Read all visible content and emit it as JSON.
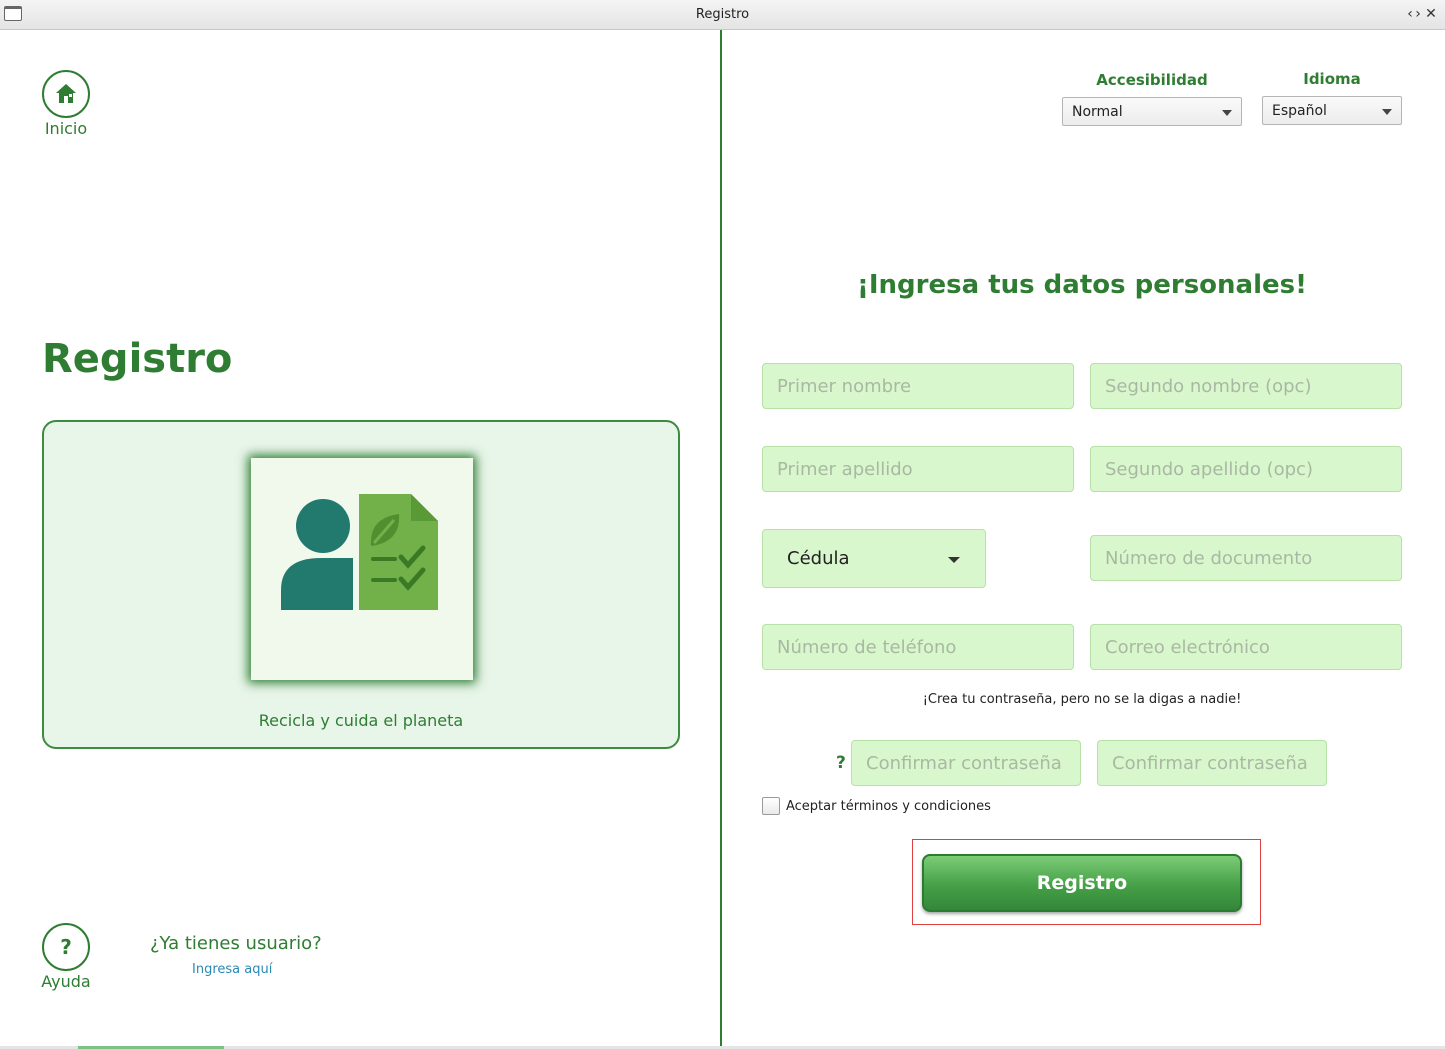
{
  "window": {
    "title": "Registro",
    "minimize_glyph": "‹",
    "maximize_glyph": "›",
    "close_glyph": "✕"
  },
  "left_panel": {
    "home": {
      "icon": "home-icon",
      "label": "Inicio"
    },
    "title": "Registro",
    "card": {
      "illustration": "user-eco-document-icon",
      "caption": "Recicla y cuida el planeta"
    },
    "help": {
      "icon": "question-icon",
      "glyph": "?",
      "label": "Ayuda"
    },
    "login_prompt": {
      "question": "¿Ya tienes usuario?",
      "link": "Ingresa aquí"
    }
  },
  "right_panel": {
    "accessibility": {
      "label": "Accesibilidad",
      "value": "Normal"
    },
    "language": {
      "label": "Idioma",
      "value": "Español"
    },
    "heading": "¡Ingresa tus datos personales!",
    "fields": {
      "first_name": "Primer nombre",
      "second_name": "Segundo nombre (opc)",
      "first_surname": "Primer apellido",
      "second_surname": "Segundo apellido (opc)",
      "document_type": "Cédula",
      "document_number": "Número de documento",
      "phone": "Número de teléfono",
      "email": "Correo electrónico"
    },
    "password_hint": "¡Crea tu contraseña, pero no se la digas a nadie!",
    "password_help_glyph": "?",
    "password": "Confirmar contraseña",
    "password_confirm": "Confirmar contraseña",
    "terms_label": "Aceptar términos y condiciones",
    "terms_checked": false,
    "submit_label": "Registro"
  },
  "colors": {
    "primary": "#2e7d32",
    "field_bg": "#d9f7cc",
    "card_bg": "#e8f5e9",
    "link": "#2a8ab5"
  }
}
